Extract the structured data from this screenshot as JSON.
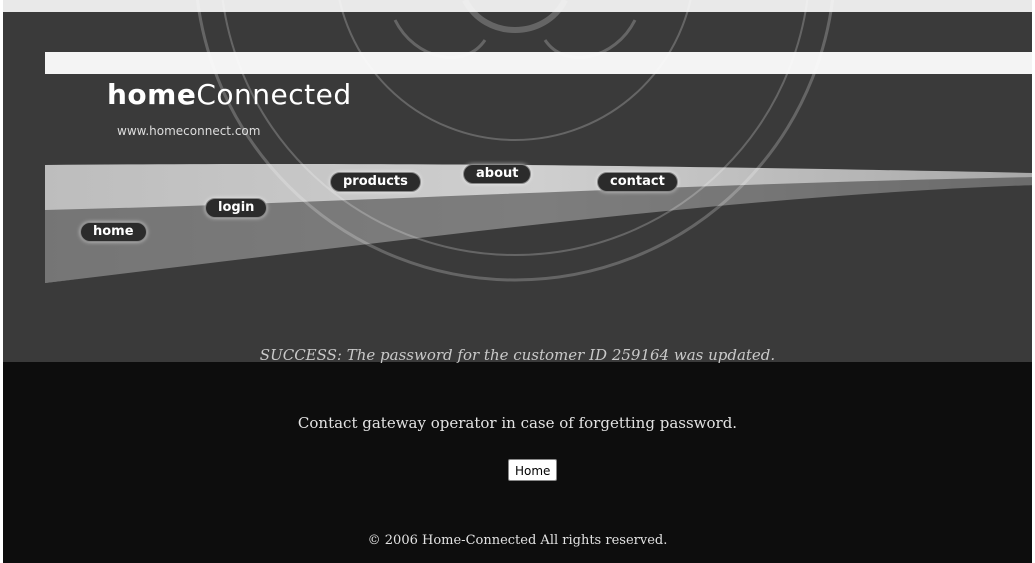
{
  "brand": {
    "logo_bold": "home",
    "logo_regular": "Connected",
    "tagline": "www.homeconnect.com"
  },
  "nav": {
    "items": [
      {
        "label": "products"
      },
      {
        "label": "about"
      },
      {
        "label": "contact"
      },
      {
        "label": "login"
      },
      {
        "label": "home"
      }
    ]
  },
  "main": {
    "status_message": "SUCCESS: The password for the customer ID 259164 was updated.",
    "help_text": "Contact gateway operator in case of forgetting password.",
    "home_button_label": "Home"
  },
  "footer": {
    "copyright": "© 2006 Home-Connected All rights reserved."
  },
  "colors": {
    "background": "#0d0d0d",
    "header_band": "#3a3a3a",
    "text_light": "#e2e2e2"
  }
}
